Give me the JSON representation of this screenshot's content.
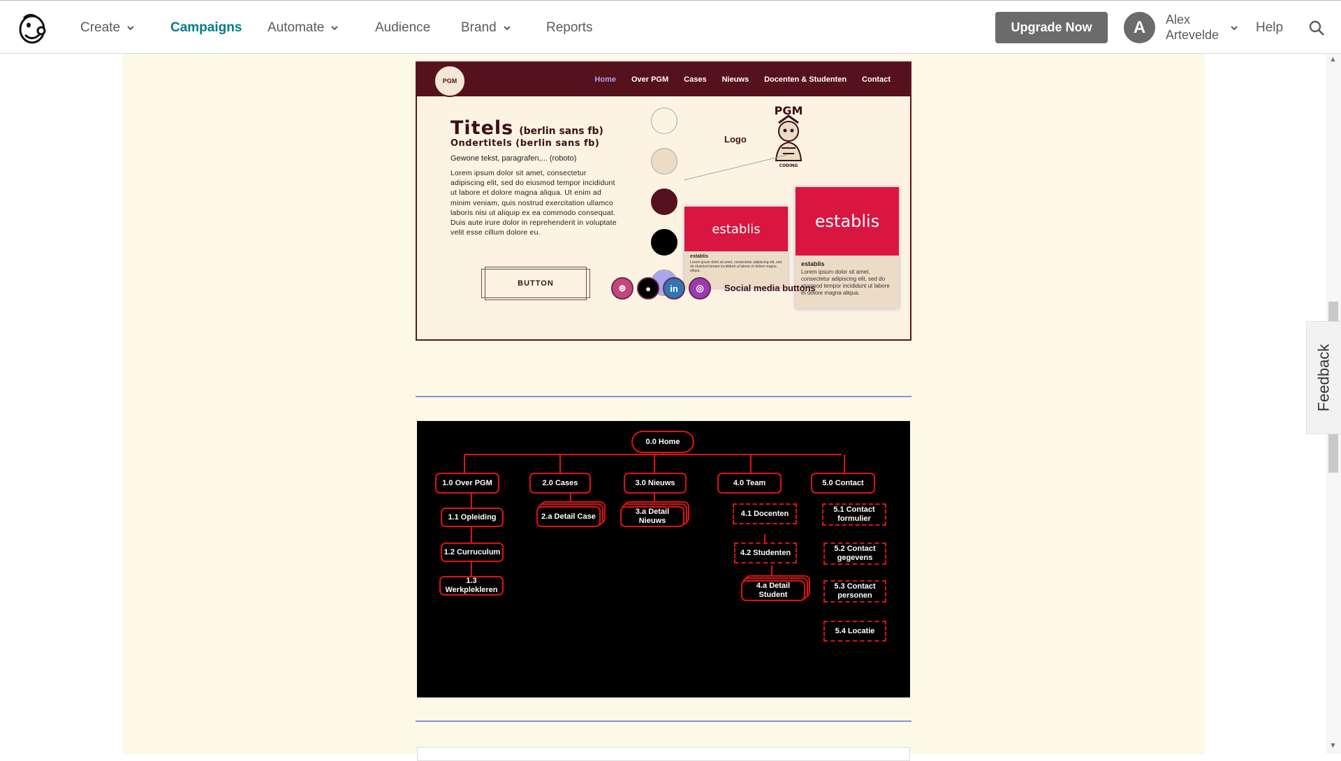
{
  "nav": {
    "items": [
      {
        "label": "Create",
        "dropdown": true
      },
      {
        "label": "Campaigns",
        "active": true
      },
      {
        "label": "Automate",
        "dropdown": true
      },
      {
        "label": "Audience"
      },
      {
        "label": "Brand",
        "dropdown": true
      },
      {
        "label": "Reports"
      }
    ],
    "upgrade_label": "Upgrade Now",
    "avatar_initial": "A",
    "user_name": "Alex Artevelde",
    "help_label": "Help",
    "icons": {
      "logo": "mailchimp-logo-icon",
      "search": "search-icon",
      "chevron": "chevron-down-icon"
    },
    "accent_color": "#007c89"
  },
  "feedback_label": "Feedback",
  "styleguide": {
    "menu": [
      "Home",
      "Over PGM",
      "Cases",
      "Nieuws",
      "Docenten & Studenten",
      "Contact"
    ],
    "badge_text": "PGM",
    "title": "Titels",
    "title_font": "(berlin sans fb)",
    "subtitle": "Ondertitels (berlin sans fb)",
    "body_label": "Gewone tekst, paragrafen,... (roboto)",
    "lorem": "Lorem ipsum dolor sit amet, consectetur adipiscing elit, sed do eiusmod tempor incididunt ut labore et dolore magna aliqua. Ut enim ad minim veniam, quis nostrud exercitation ullamco laboris nisi ut aliquip ex ea commodo consequat. Duis aute irure dolor in reprehenderit in voluptate velit esse cillum dolore eu.",
    "button_label": "BUTTON",
    "swatches": [
      "#fcf3e2",
      "#ecdcc6",
      "#55121d",
      "#000000",
      "#a9a6ee"
    ],
    "logo_label": "Logo",
    "logo_text": "PGM",
    "logo_caption": "CODING",
    "card_brand": "establis",
    "card_title": "establis",
    "card_small_text": "Lorem ipsum dolor sit amet, consectetur adipiscing elit, sed do eiusmod tempor incididunt ut labore et dolore magna aliqua.",
    "card_large_text": "Lorem ipsum dolor sit amet, consectetur adipiscing elit, sed do eiusmod tempor incididunt ut labore et dolore magna aliqua.",
    "social": [
      {
        "icon": "dribbble-icon",
        "color": "#c2477c",
        "glyph": "⊛"
      },
      {
        "icon": "github-icon",
        "color": "#000000",
        "glyph": "●"
      },
      {
        "icon": "linkedin-icon",
        "color": "#2f76b3",
        "glyph": "in"
      },
      {
        "icon": "instagram-icon",
        "color": "#9b3bb3",
        "glyph": "◎"
      }
    ],
    "social_label": "Social media buttons"
  },
  "sitemap": {
    "home": "0.0 Home",
    "sections": [
      {
        "label": "1.0 Over PGM",
        "children": [
          "1.1 Opleiding",
          "1.2 Curruculum",
          "1.3 Werkplekleren"
        ]
      },
      {
        "label": "2.0 Cases",
        "children": [
          "2.a Detail Case"
        ]
      },
      {
        "label": "3.0 Nieuws",
        "children": [
          "3.a Detail Nieuws"
        ]
      },
      {
        "label": "4.0 Team",
        "children": [
          "4.1 Docenten",
          "4.2 Studenten",
          "4.a Detail Student"
        ]
      },
      {
        "label": "5.0 Contact",
        "children": [
          "5.1 Contact formulier",
          "5.2 Contact gegevens",
          "5.3 Contact personen",
          "5.4 Locatie"
        ]
      }
    ],
    "line_color": "#e01212"
  }
}
